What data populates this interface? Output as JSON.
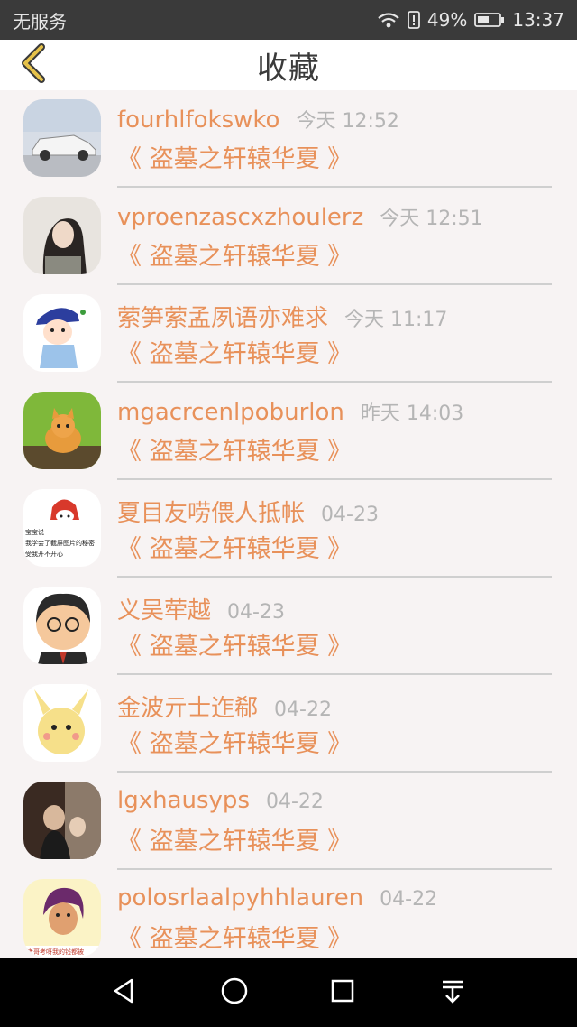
{
  "status_bar": {
    "carrier": "无服务",
    "battery": "49%",
    "time": "13:37"
  },
  "header": {
    "title": "收藏"
  },
  "items": [
    {
      "name": "fourhlfokswko",
      "time": "今天 12:52",
      "book": "《 盗墓之轩辕华夏 》"
    },
    {
      "name": "vproenzascxzhoulerz",
      "time": "今天 12:51",
      "book": "《 盗墓之轩辕华夏 》"
    },
    {
      "name": "萦笋萦孟夙语亦难求",
      "time": "今天 11:17",
      "book": "《 盗墓之轩辕华夏 》"
    },
    {
      "name": "mgacrcenlpoburlon",
      "time": "昨天 14:03",
      "book": "《 盗墓之轩辕华夏 》"
    },
    {
      "name": "夏目友唠偎人抵帐",
      "time": "04-23",
      "book": "《 盗墓之轩辕华夏 》"
    },
    {
      "name": "义吴荦越",
      "time": "04-23",
      "book": "《 盗墓之轩辕华夏 》"
    },
    {
      "name": "金波亓士迮郗",
      "time": "04-22",
      "book": "《 盗墓之轩辕华夏 》"
    },
    {
      "name": "lgxhausyps",
      "time": "04-22",
      "book": "《 盗墓之轩辕华夏 》"
    },
    {
      "name": "polosrlaalpyhhlauren",
      "time": "04-22",
      "book": "《 盗墓之轩辕华夏 》"
    }
  ],
  "avatar_texts": {
    "meme_caption_1": "宝宝说",
    "meme_caption_2": "我学会了截屏图片的秘密",
    "meme_caption_3": "受我开不开心",
    "sticker_caption": "考哥考呀我的钱都被"
  },
  "icons": {
    "back": "chevron-left-icon",
    "wifi": "wifi-icon",
    "sim": "sim-alert-icon",
    "battery": "battery-icon",
    "nav_back": "triangle-back-icon",
    "nav_home": "circle-home-icon",
    "nav_recent": "square-recent-icon",
    "nav_down": "notification-pull-icon"
  },
  "colors": {
    "accent": "#e8915a",
    "time_gray": "#b5b5b5",
    "header_back": "#e6c24a"
  }
}
